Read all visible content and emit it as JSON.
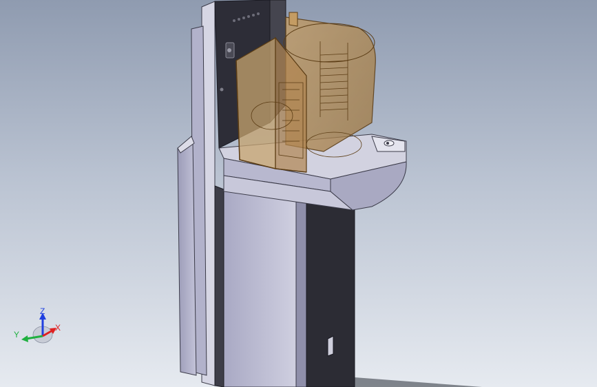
{
  "viewport": {
    "background_top": "#8f9bb0",
    "background_bottom": "#e6eaf0",
    "model_colors": {
      "body_light": "#b9b9cf",
      "body_mid": "#a3a3bd",
      "body_dark": "#2b2b35",
      "enclosure_glass": "#b7935e",
      "enclosure_edge": "#5b3c14"
    }
  },
  "triad": {
    "x_label": "X",
    "y_label": "Y",
    "z_label": "Z",
    "x_color": "#e02020",
    "y_color": "#20b040",
    "z_color": "#2040e0"
  }
}
